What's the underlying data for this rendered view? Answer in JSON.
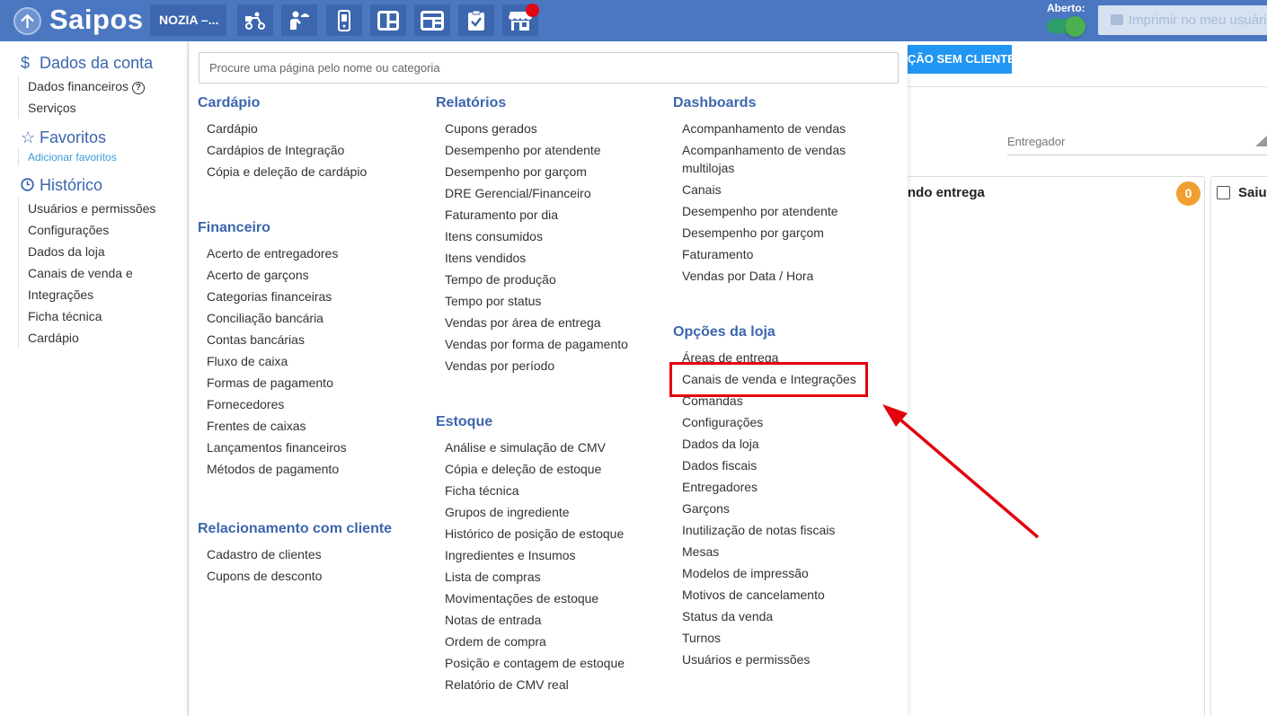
{
  "header": {
    "logo": "Saipos",
    "store": "NOZIA –...",
    "nav_icons": [
      "delivery-scooter-icon",
      "waiter-icon",
      "phone-order-icon",
      "kanban-board-icon",
      "table-layout-icon",
      "clipboard-check-icon",
      "store-icon"
    ],
    "aberto_label": "Aberto:",
    "print_label": "Imprimir no meu usuário"
  },
  "sidebar": {
    "account_title": "Dados da conta",
    "account_items": [
      "Dados financeiros",
      "Serviços"
    ],
    "favorites_title": "Favoritos",
    "favorites_link": "Adicionar favoritos",
    "history_title": "Histórico",
    "history_items": [
      "Usuários e permissões",
      "Configurações",
      "Dados da loja",
      "Canais de venda e Integrações",
      "Ficha técnica",
      "Cardápio"
    ]
  },
  "search": {
    "placeholder": "Procure uma página pelo nome ou categoria"
  },
  "menu": {
    "cardapio": {
      "title": "Cardápio",
      "items": [
        "Cardápio",
        "Cardápios de Integração",
        "Cópia e deleção de cardápio"
      ]
    },
    "financeiro": {
      "title": "Financeiro",
      "items": [
        "Acerto de entregadores",
        "Acerto de garçons",
        "Categorias financeiras",
        "Conciliação bancária",
        "Contas bancárias",
        "Fluxo de caixa",
        "Formas de pagamento",
        "Fornecedores",
        "Frentes de caixas",
        "Lançamentos financeiros",
        "Métodos de pagamento"
      ]
    },
    "relacionamento": {
      "title": "Relacionamento com cliente",
      "items": [
        "Cadastro de clientes",
        "Cupons de desconto"
      ]
    },
    "relatorios": {
      "title": "Relatórios",
      "items": [
        "Cupons gerados",
        "Desempenho por atendente",
        "Desempenho por garçom",
        "DRE Gerencial/Financeiro",
        "Faturamento por dia",
        "Itens consumidos",
        "Itens vendidos",
        "Tempo de produção",
        "Tempo por status",
        "Vendas por área de entrega",
        "Vendas por forma de pagamento",
        "Vendas por período"
      ]
    },
    "estoque": {
      "title": "Estoque",
      "items": [
        "Análise e simulação de CMV",
        "Cópia e deleção de estoque",
        "Ficha técnica",
        "Grupos de ingrediente",
        "Histórico de posição de estoque",
        "Ingredientes e Insumos",
        "Lista de compras",
        "Movimentações de estoque",
        "Notas de entrada",
        "Ordem de compra",
        "Posição e contagem de estoque",
        "Relatório de CMV real"
      ]
    },
    "dashboards": {
      "title": "Dashboards",
      "items": [
        "Acompanhamento de vendas",
        "Acompanhamento de vendas multilojas",
        "Canais",
        "Desempenho por atendente",
        "Desempenho por garçom",
        "Faturamento",
        "Vendas por Data / Hora"
      ]
    },
    "opcoes": {
      "title": "Opções da loja",
      "items": [
        "Áreas de entrega",
        "Canais de venda e Integrações",
        "Comandas",
        "Configurações",
        "Dados da loja",
        "Dados fiscais",
        "Entregadores",
        "Garçons",
        "Inutilização de notas fiscais",
        "Mesas",
        "Modelos de impressão",
        "Motivos de cancelamento",
        "Status da venda",
        "Turnos",
        "Usuários e permissões"
      ]
    }
  },
  "background": {
    "button_label": "ÇÃO SEM CLIENTE",
    "entregador_label": "Entregador",
    "column1_title": "ndo entrega",
    "column1_count": "0",
    "column2_title": "Saiu"
  },
  "colors": {
    "topbar": "#4a77c0",
    "accent": "#3c66ad",
    "highlight": "#e3000f"
  }
}
